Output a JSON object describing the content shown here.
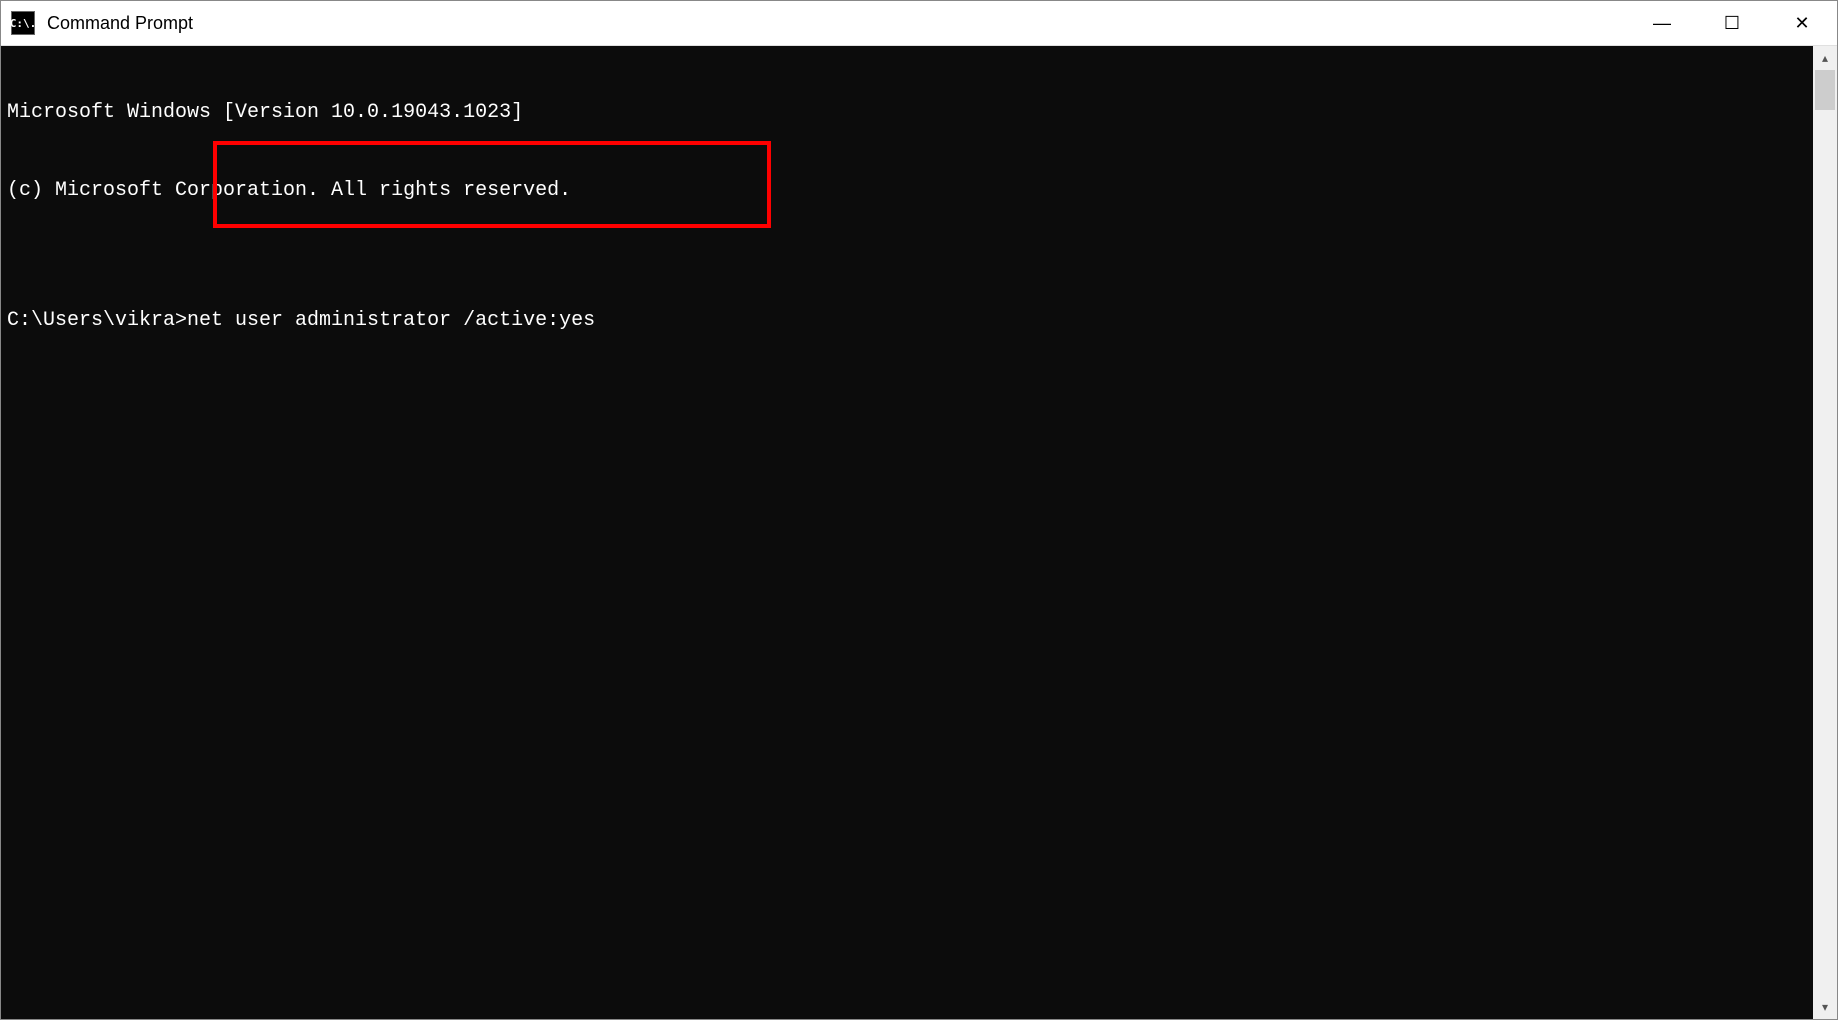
{
  "window": {
    "title": "Command Prompt",
    "icon_label": "C:\\."
  },
  "terminal": {
    "line1": "Microsoft Windows [Version 10.0.19043.1023]",
    "line2": "(c) Microsoft Corporation. All rights reserved.",
    "blank": "",
    "prompt": "C:\\Users\\vikra>",
    "command": "net user administrator /active:yes"
  },
  "highlight": {
    "left_px": "212",
    "top_px": "140",
    "width_px": "558",
    "height_px": "87"
  },
  "controls": {
    "minimize_glyph": "—",
    "maximize_glyph": "☐",
    "close_glyph": "✕"
  },
  "scrollbar": {
    "up_glyph": "▴",
    "down_glyph": "▾"
  }
}
